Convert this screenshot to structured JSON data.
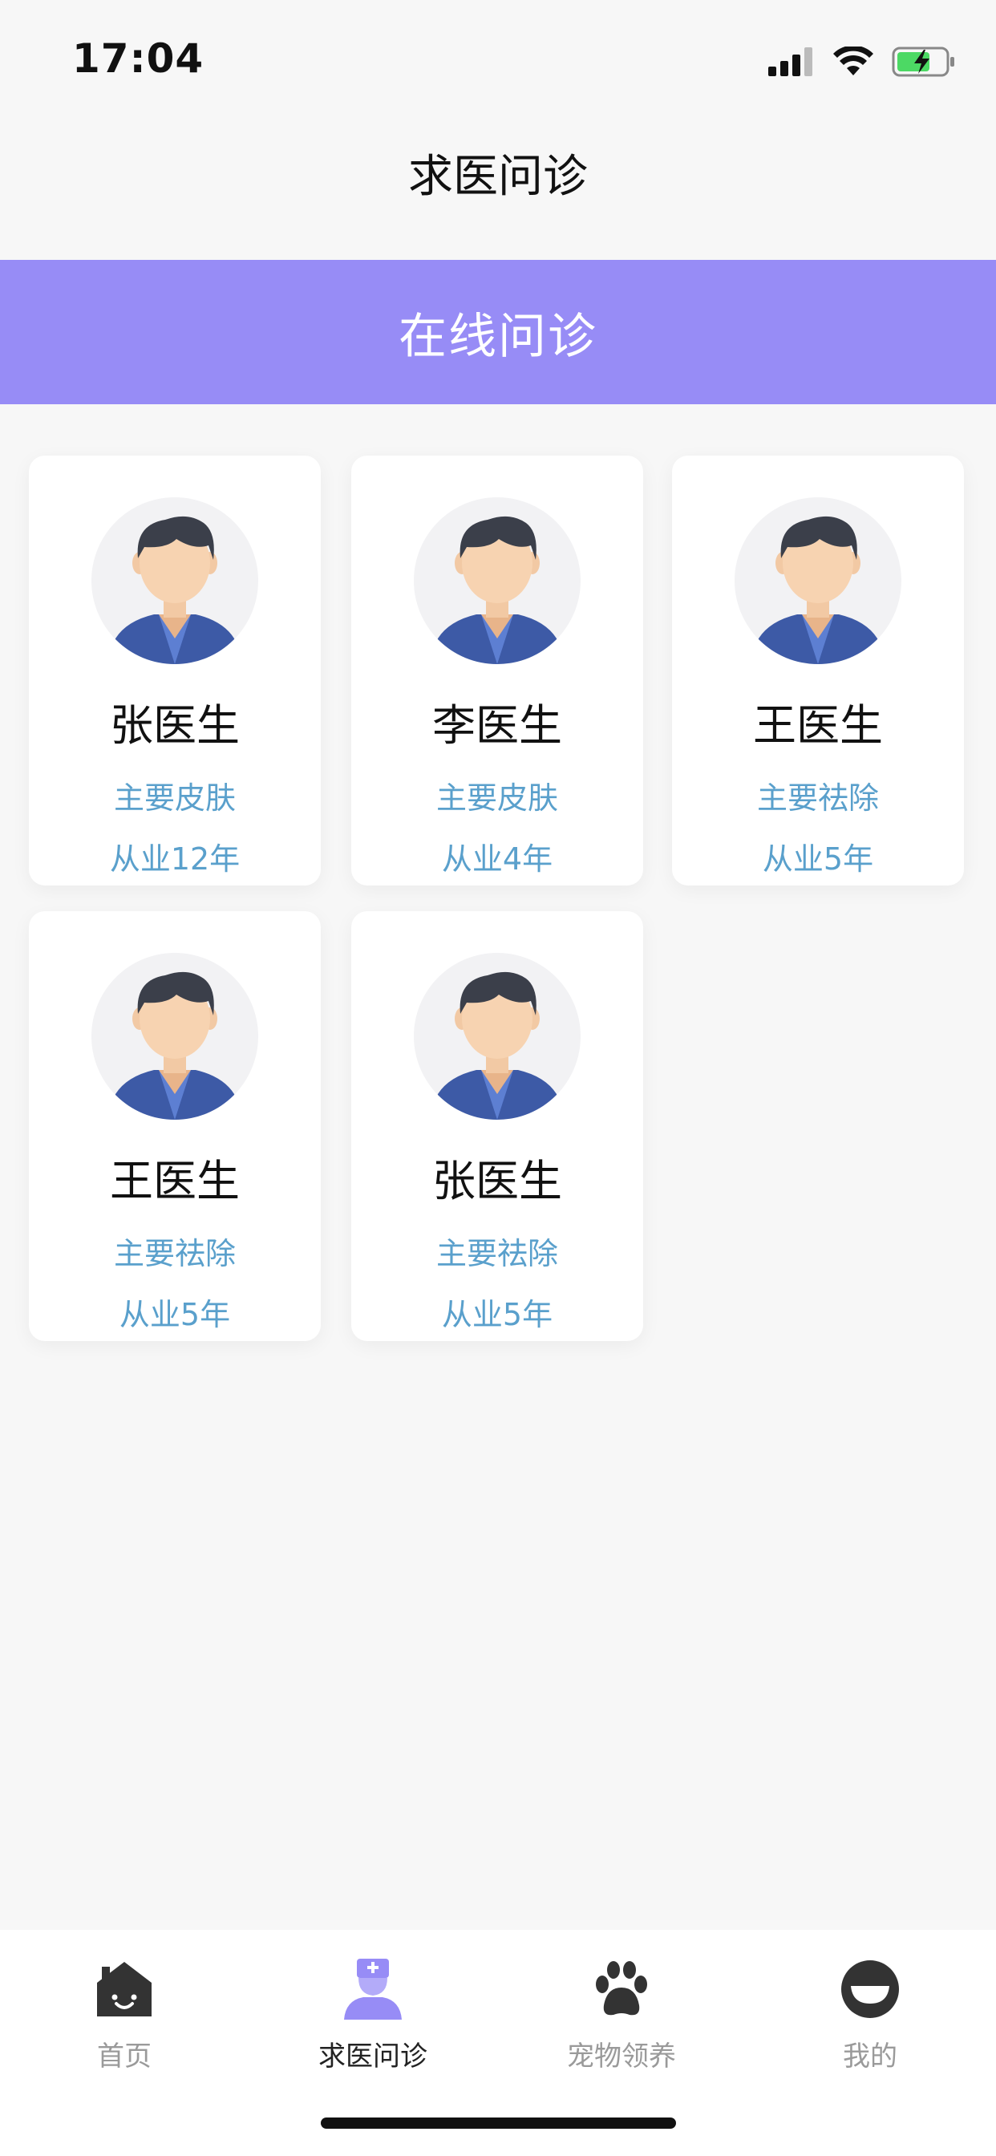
{
  "status_bar": {
    "time": "17:04",
    "icons": [
      "cellular-signal-icon",
      "wifi-icon",
      "battery-charging-icon"
    ],
    "battery_color": "#4cd964"
  },
  "header": {
    "title": "求医问诊"
  },
  "banner": {
    "label": "在线问诊",
    "color": "#978cf6"
  },
  "doctors": [
    {
      "name": "张医生",
      "specialty": "主要皮肤",
      "experience": "从业12年",
      "avatar_icon": "doctor-avatar-icon"
    },
    {
      "name": "李医生",
      "specialty": "主要皮肤",
      "experience": "从业4年",
      "avatar_icon": "doctor-avatar-icon"
    },
    {
      "name": "王医生",
      "specialty": "主要祛除",
      "experience": "从业5年",
      "avatar_icon": "doctor-avatar-icon"
    },
    {
      "name": "王医生",
      "specialty": "主要祛除",
      "experience": "从业5年",
      "avatar_icon": "doctor-avatar-icon"
    },
    {
      "name": "张医生",
      "specialty": "主要祛除",
      "experience": "从业5年",
      "avatar_icon": "doctor-avatar-icon"
    }
  ],
  "tab_bar": {
    "items": [
      {
        "label": "首页",
        "icon": "home-icon",
        "active": false
      },
      {
        "label": "求医问诊",
        "icon": "nurse-icon",
        "active": true
      },
      {
        "label": "宠物领养",
        "icon": "paw-icon",
        "active": false
      },
      {
        "label": "我的",
        "icon": "profile-icon",
        "active": false
      }
    ],
    "active_color": "#978cf6"
  }
}
